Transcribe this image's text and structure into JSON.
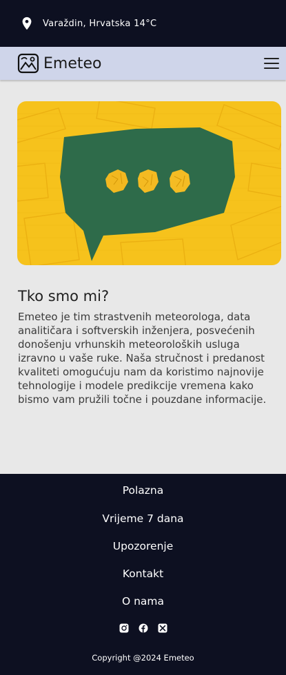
{
  "topbar": {
    "location_text": "Varaždin, Hrvatska 14°C",
    "icon": "location-pin-icon"
  },
  "header": {
    "brand": "Emeteo",
    "logo_icon": "emeteo-logo-icon",
    "menu_icon": "hamburger-menu-icon"
  },
  "hero": {
    "image": "speech-bubble-with-paper-balls"
  },
  "about": {
    "title": "Tko smo mi?",
    "text": "Emeteo je tim strastvenih meteorologa, data analitičara i softverskih inženjera, posvećenih donošenju vrhunskih meteoroloških usluga izravno u vaše ruke. Naša stručnost i predanost kvaliteti omogućuju nam da koristimo najnovije tehnologije i modele predikcije vremena kako bismo vam pružili točne i pouzdane informacije."
  },
  "footer": {
    "links": [
      "Polazna",
      "Vrijeme 7 dana",
      "Upozorenje",
      "Kontakt",
      "O nama"
    ],
    "socials": [
      "instagram-icon",
      "facebook-icon",
      "x-icon"
    ],
    "copyright": "Copyright @2024 Emeteo"
  },
  "colors": {
    "dark": "#0d1021",
    "nav": "#cfd5ea",
    "background": "#e8e8e8",
    "hero_yellow": "#f6c21c",
    "hero_green": "#2e6b4a"
  }
}
